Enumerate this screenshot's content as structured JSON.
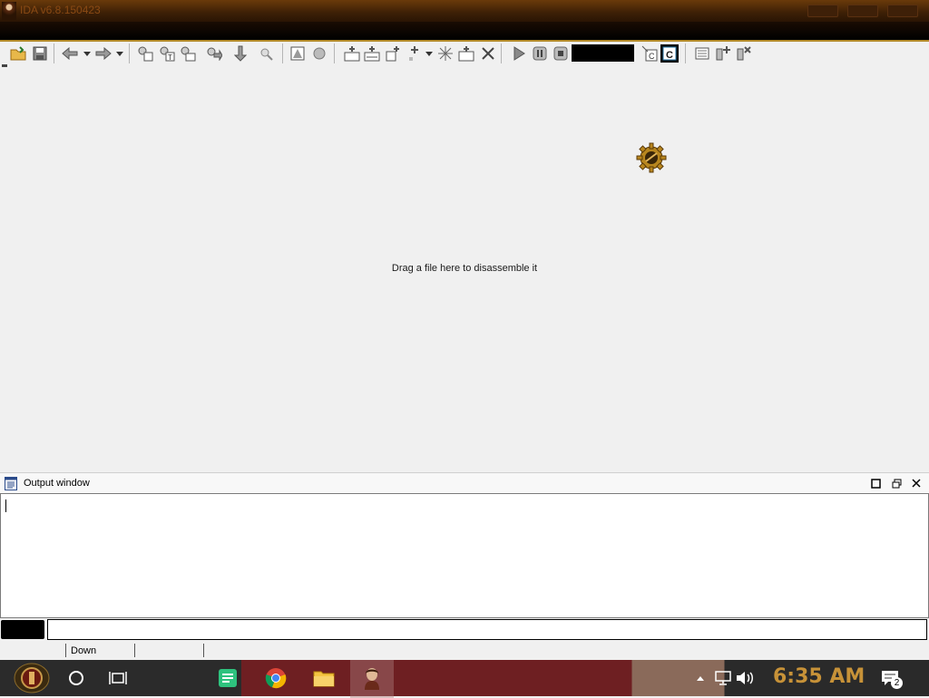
{
  "window": {
    "title": "IDA v6.8.150423"
  },
  "toolbar": {
    "icons": [
      "open-icon",
      "save-icon",
      "back-icon",
      "forward-icon",
      "search-icon",
      "run-icon",
      "pause-icon",
      "stop-icon"
    ]
  },
  "main": {
    "drop_hint": "Drag a file here to disassemble it"
  },
  "output_window": {
    "title": "Output window"
  },
  "statusbar": {
    "direction": "Down"
  },
  "taskbar": {
    "clock": "6:35 AM",
    "notification_count": "2"
  },
  "colors": {
    "titlebar": "#3c1f06",
    "toolbar_accent": "#b38a2a",
    "clock": "#c79238"
  }
}
